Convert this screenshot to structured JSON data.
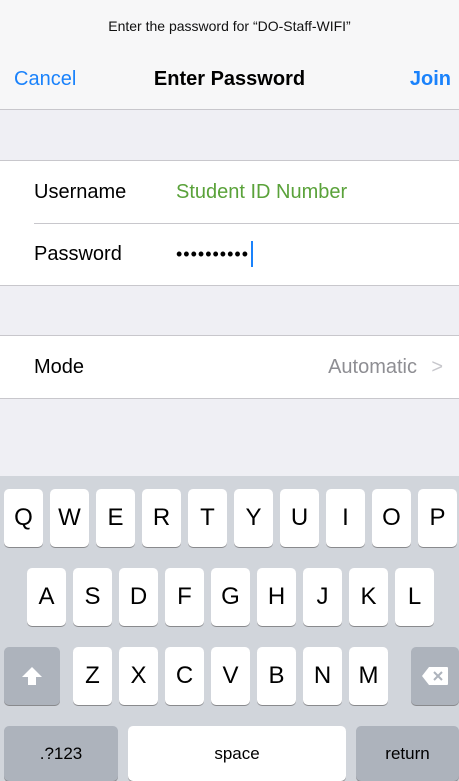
{
  "header": {
    "prompt": "Enter the password for “DO-Staff-WIFI”",
    "cancel_label": "Cancel",
    "title": "Enter Password",
    "join_label": "Join"
  },
  "credentials": {
    "username_label": "Username",
    "username_placeholder": "Student ID Number",
    "password_label": "Password",
    "password_value": "••••••••••"
  },
  "mode": {
    "label": "Mode",
    "value": "Automatic",
    "chevron": ">"
  },
  "keyboard": {
    "row1": [
      "Q",
      "W",
      "E",
      "R",
      "T",
      "Y",
      "U",
      "I",
      "O",
      "P"
    ],
    "row2": [
      "A",
      "S",
      "D",
      "F",
      "G",
      "H",
      "J",
      "K",
      "L"
    ],
    "row3": [
      "Z",
      "X",
      "C",
      "V",
      "B",
      "N",
      "M"
    ],
    "shift_icon": "shift-arrow-icon",
    "delete_icon": "backspace-icon",
    "numbers_label": ".?123",
    "space_label": "space",
    "return_label": "return"
  },
  "colors": {
    "accent": "#1a82fb",
    "placeholder": "#5aa23a",
    "secondary_text": "#8e8e93",
    "background": "#efeff4",
    "keyboard_bg": "#d1d5db"
  }
}
